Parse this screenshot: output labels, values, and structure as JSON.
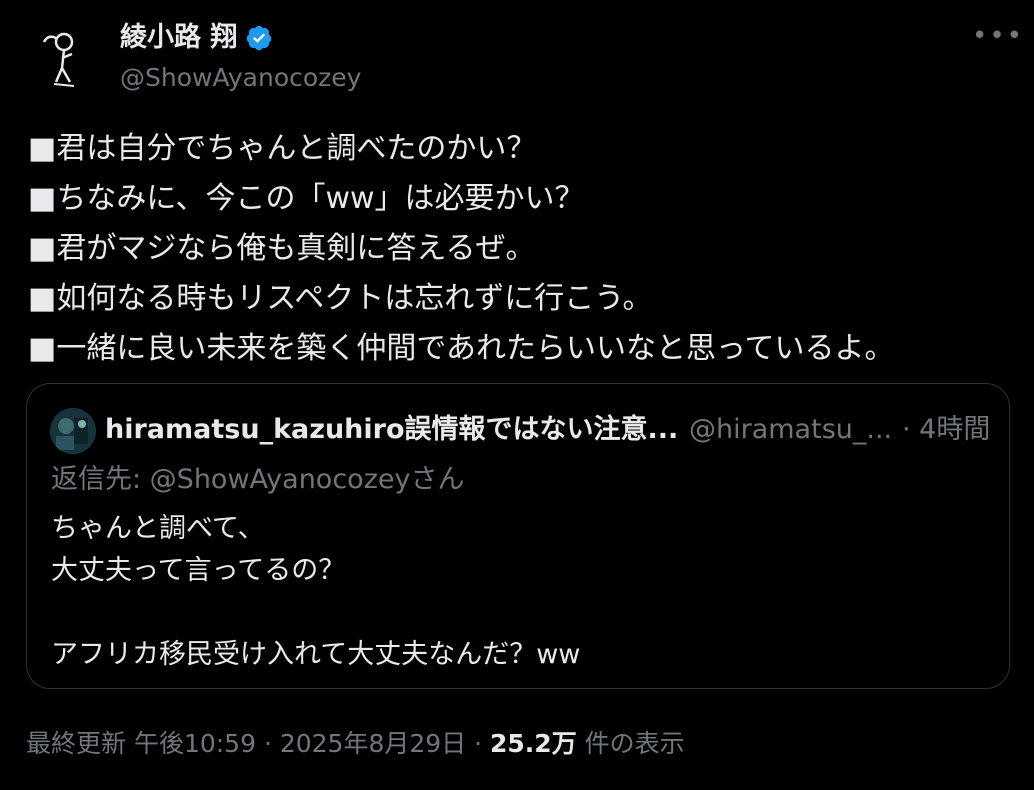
{
  "author": {
    "display_name": "綾小路 翔",
    "handle": "@ShowAyanocozey",
    "verified": true,
    "avatar_icon": "doodle-figure-avatar",
    "verified_icon": "verified-badge-icon",
    "accent_color": "#1d9bf0"
  },
  "more_label": "•••",
  "tweet_lines": [
    "■君は自分でちゃんと調べたのかい？",
    "■ちなみに、今この「ww」は必要かい？",
    "■君がマジなら俺も真剣に答えるぜ。",
    "■如何なる時もリスペクトは忘れずに行こう。",
    "■一緒に良い未来を築く仲間であれたらいいなと思っているよ。"
  ],
  "quote": {
    "name": "hiramatsu_kazuhiro誤情報ではない注意...",
    "handle": "@hiramatsu_...",
    "time": "· 4時間",
    "reply_to": "返信先: @ShowAyanocozeyさん",
    "text": "ちゃんと調べて、\n大丈夫って言ってるの？\n\nアフリカ移民受け入れて大丈夫なんだ？ww"
  },
  "footer": {
    "meta": "最終更新 午後10:59 · 2025年8月29日 · ",
    "views_count": "25.2万",
    "views_label": " 件の表示"
  }
}
